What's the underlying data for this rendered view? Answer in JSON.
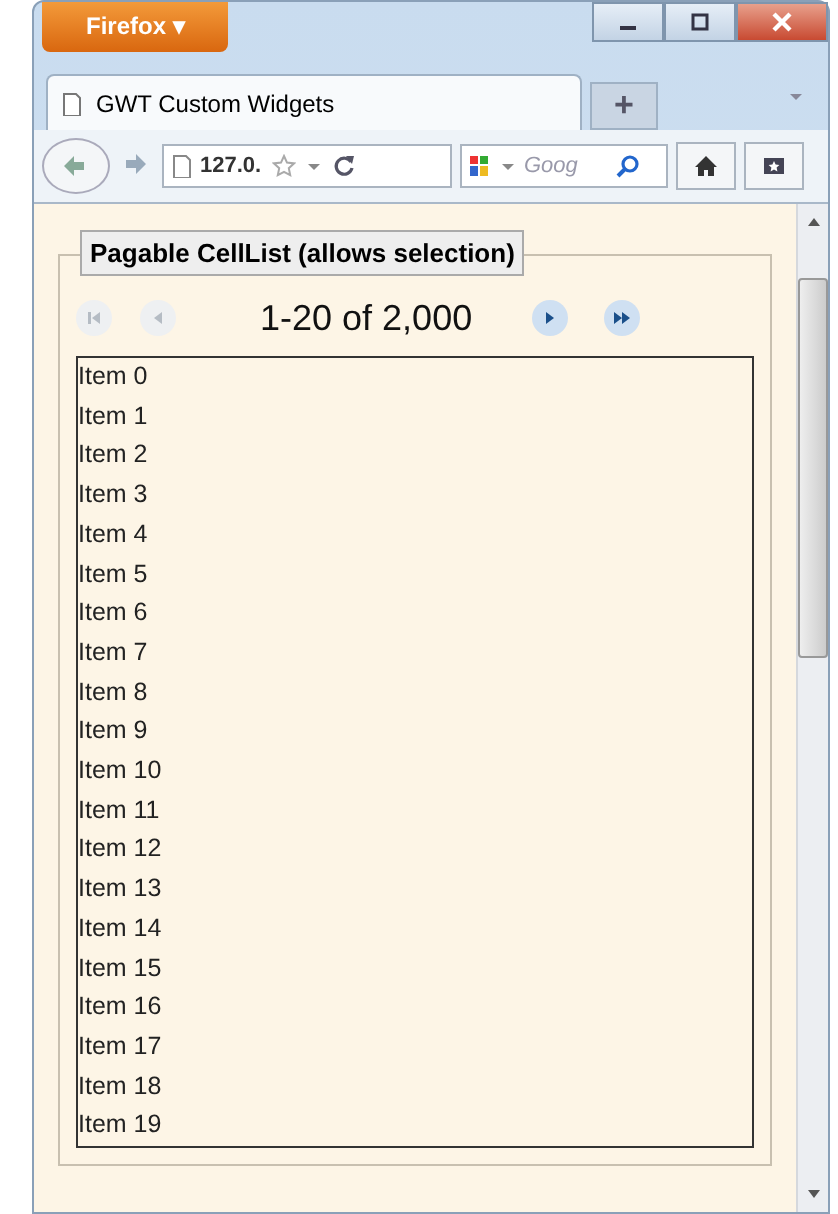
{
  "browser": {
    "menu_button": "Firefox ▾",
    "tabs": [
      {
        "title": "GWT Custom Widgets",
        "selected": true
      }
    ],
    "new_tab": "+",
    "url": "127.0. ",
    "search_placeholder": "Goog"
  },
  "fieldset": {
    "legend": "Pagable CellList (allows selection)"
  },
  "pager": {
    "range": "1-20 of 2,000",
    "buttons": [
      {
        "kind": "first",
        "disabled": true
      },
      {
        "kind": "prev",
        "disabled": true
      },
      {
        "kind": "next",
        "disabled": false
      },
      {
        "kind": "last",
        "disabled": false
      }
    ]
  },
  "items": [
    "Item 0",
    "Item 1",
    "Item 2",
    "Item 3",
    "Item 4",
    "Item 5",
    "Item 6",
    "Item 7",
    "Item 8",
    "Item 9",
    "Item 10",
    "Item 11",
    "Item 12",
    "Item 13",
    "Item 14",
    "Item 15",
    "Item 16",
    "Item 17",
    "Item 18",
    "Item 19"
  ]
}
